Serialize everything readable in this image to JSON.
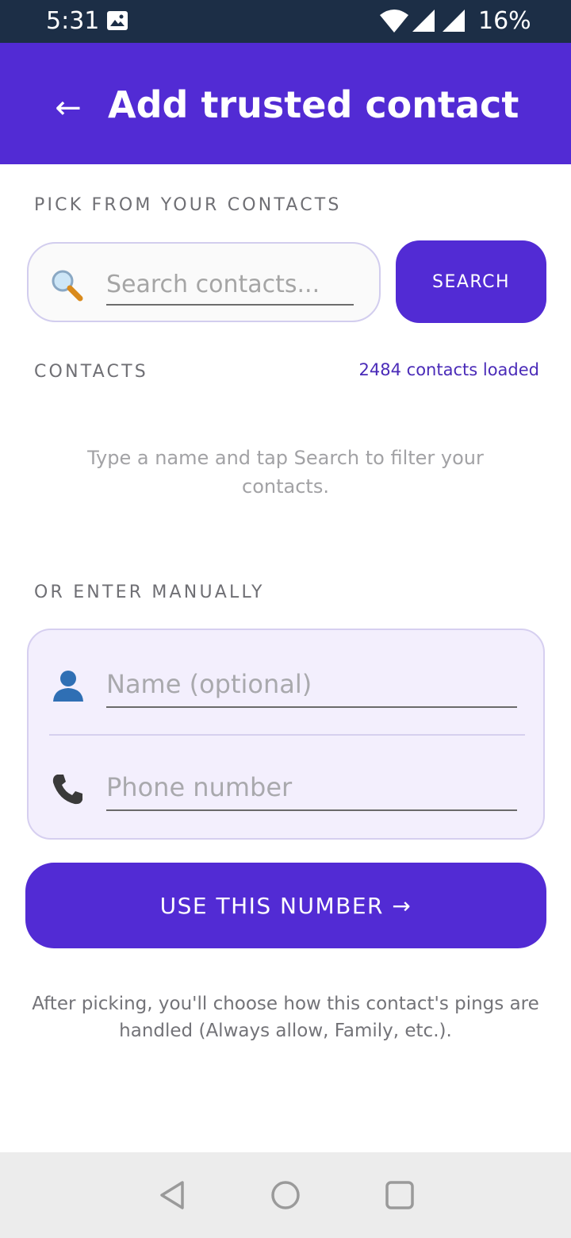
{
  "status_bar": {
    "time": "5:31",
    "battery": "16%",
    "icons": [
      "gallery-icon",
      "wifi-icon",
      "signal-icon",
      "signal-icon"
    ]
  },
  "app_bar": {
    "back_icon": "←",
    "title": "Add trusted contact"
  },
  "pick_section": {
    "label": "PICK FROM YOUR CONTACTS",
    "search_placeholder": "Search contacts...",
    "search_icon": "magnifier-icon",
    "search_button": "SEARCH"
  },
  "contacts_section": {
    "label": "CONTACTS",
    "count_text": "2484 contacts loaded",
    "empty_hint": "Type a name and tap Search to filter your contacts."
  },
  "manual_section": {
    "label": "OR ENTER MANUALLY",
    "name_placeholder": "Name (optional)",
    "phone_placeholder": "Phone number",
    "name_icon": "person-icon",
    "phone_icon": "phone-icon"
  },
  "use_button": "USE THIS NUMBER →",
  "footer_note": "After picking, you'll choose how this contact's pings are handled (Always allow, Family, etc.).",
  "colors": {
    "primary": "#522bd4",
    "status_bar": "#1c2e46",
    "card_bg": "#f3effd",
    "accent_text": "#4a2bb8"
  }
}
